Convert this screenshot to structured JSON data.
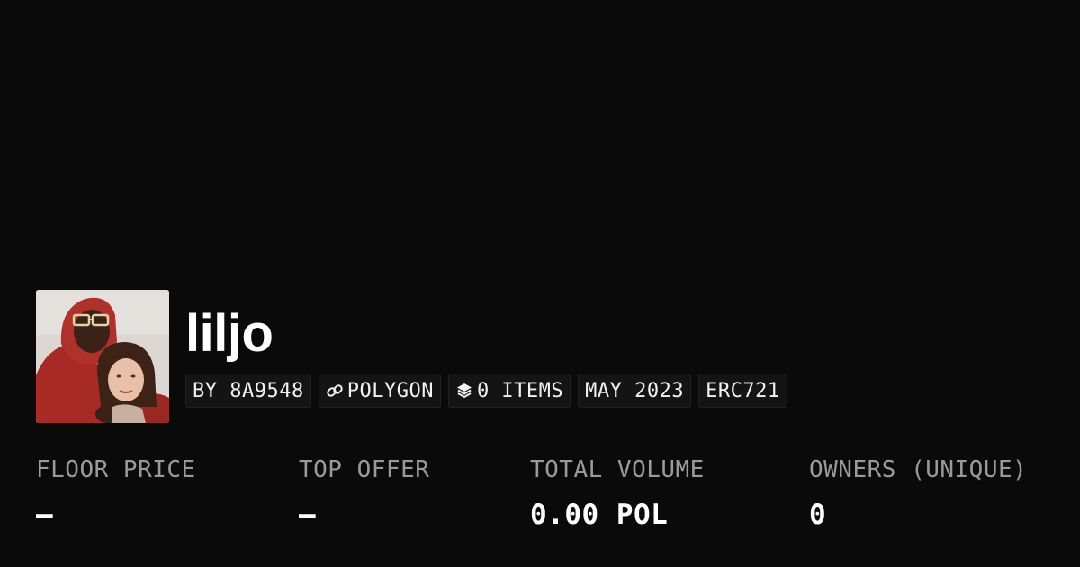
{
  "collection": {
    "name": "liljo"
  },
  "chips": {
    "creator": "BY 8A9548",
    "chain": "POLYGON",
    "items": "0 ITEMS",
    "date": "MAY 2023",
    "standard": "ERC721"
  },
  "icons": {
    "chain": "link-icon",
    "items": "layers-icon"
  },
  "stats": {
    "floor_price": {
      "label": "FLOOR PRICE",
      "value": "–"
    },
    "top_offer": {
      "label": "TOP OFFER",
      "value": "–"
    },
    "total_volume": {
      "label": "TOTAL VOLUME",
      "value": "0.00 POL"
    },
    "owners": {
      "label": "OWNERS (UNIQUE)",
      "value": "0"
    }
  },
  "colors": {
    "background": "#0a0a0a",
    "chip_background": "#141414",
    "label": "#9a9a9a",
    "text": "#ffffff"
  }
}
